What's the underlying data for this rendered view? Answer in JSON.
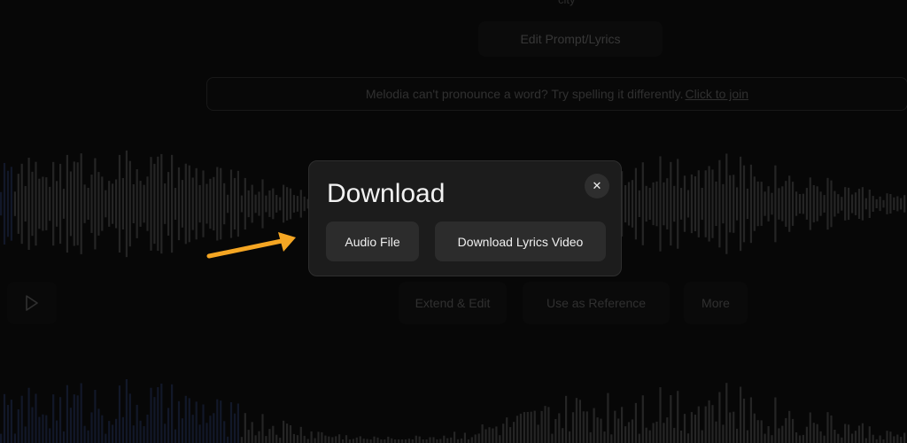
{
  "page": {
    "top_text": "city",
    "edit_button": "Edit Prompt/Lyrics",
    "notice_text": "Melodia can't pronounce a word? Try spelling it differently.",
    "notice_link": "Click to join",
    "actions": {
      "extend": "Extend & Edit",
      "reference": "Use as Reference",
      "more": "More"
    },
    "play_icon": "play-icon"
  },
  "modal": {
    "title": "Download",
    "close_icon": "close-icon",
    "close_glyph": "✕",
    "buttons": {
      "audio": "Audio File",
      "video": "Download Lyrics Video"
    }
  },
  "colors": {
    "modal_bg": "#1c1c1c",
    "button_bg": "#2c2c2c",
    "arrow": "#f5a623"
  }
}
